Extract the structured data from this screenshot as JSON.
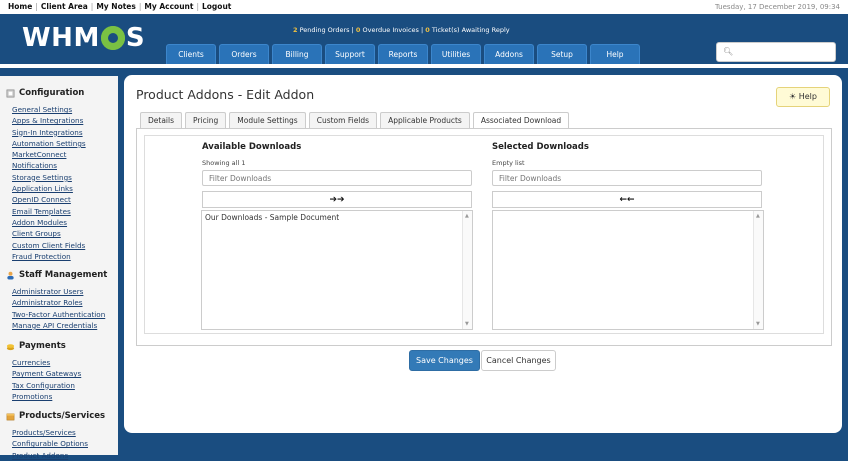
{
  "topbar": {
    "links": [
      "Home",
      "Client Area",
      "My Notes",
      "My Account",
      "Logout"
    ],
    "datetime": "Tuesday, 17 December 2019, 09:34"
  },
  "header": {
    "logo_text_left": "WHM",
    "logo_text_right": "S",
    "stats": {
      "pending_orders_count": "2",
      "pending_orders_label": "Pending Orders",
      "overdue_count": "0",
      "overdue_label": "Overdue Invoices",
      "tickets_count": "0",
      "tickets_label": "Ticket(s) Awaiting Reply"
    },
    "nav": [
      "Clients",
      "Orders",
      "Billing",
      "Support",
      "Reports",
      "Utilities",
      "Addons",
      "Setup",
      "Help"
    ]
  },
  "sidebar": {
    "sections": [
      {
        "title": "Configuration",
        "icon": "wrench-icon",
        "items": [
          "General Settings",
          "Apps & Integrations",
          "Sign-In Integrations",
          "Automation Settings",
          "MarketConnect",
          "Notifications",
          "Storage Settings",
          "Application Links",
          "OpenID Connect",
          "Email Templates",
          "Addon Modules",
          "Client Groups",
          "Custom Client Fields",
          "Fraud Protection"
        ]
      },
      {
        "title": "Staff Management",
        "icon": "users-icon",
        "items": [
          "Administrator Users",
          "Administrator Roles",
          "Two-Factor Authentication",
          "Manage API Credentials"
        ]
      },
      {
        "title": "Payments",
        "icon": "coins-icon",
        "items": [
          "Currencies",
          "Payment Gateways",
          "Tax Configuration",
          "Promotions"
        ]
      },
      {
        "title": "Products/Services",
        "icon": "box-icon",
        "items": [
          "Products/Services",
          "Configurable Options",
          "Product Addons"
        ]
      }
    ]
  },
  "main": {
    "title": "Product Addons - Edit Addon",
    "help_label": "Help",
    "tabs": [
      "Details",
      "Pricing",
      "Module Settings",
      "Custom Fields",
      "Applicable Products",
      "Associated Download"
    ],
    "active_tab": "Associated Download",
    "available": {
      "heading": "Available Downloads",
      "note": "Showing all 1",
      "filter_placeholder": "Filter Downloads",
      "move_label": "➔➔",
      "items": [
        "Our Downloads - Sample Document"
      ]
    },
    "selected": {
      "heading": "Selected Downloads",
      "note": "Empty list",
      "filter_placeholder": "Filter Downloads",
      "move_label": "←←",
      "items": []
    },
    "save_label": "Save Changes",
    "cancel_label": "Cancel Changes"
  }
}
